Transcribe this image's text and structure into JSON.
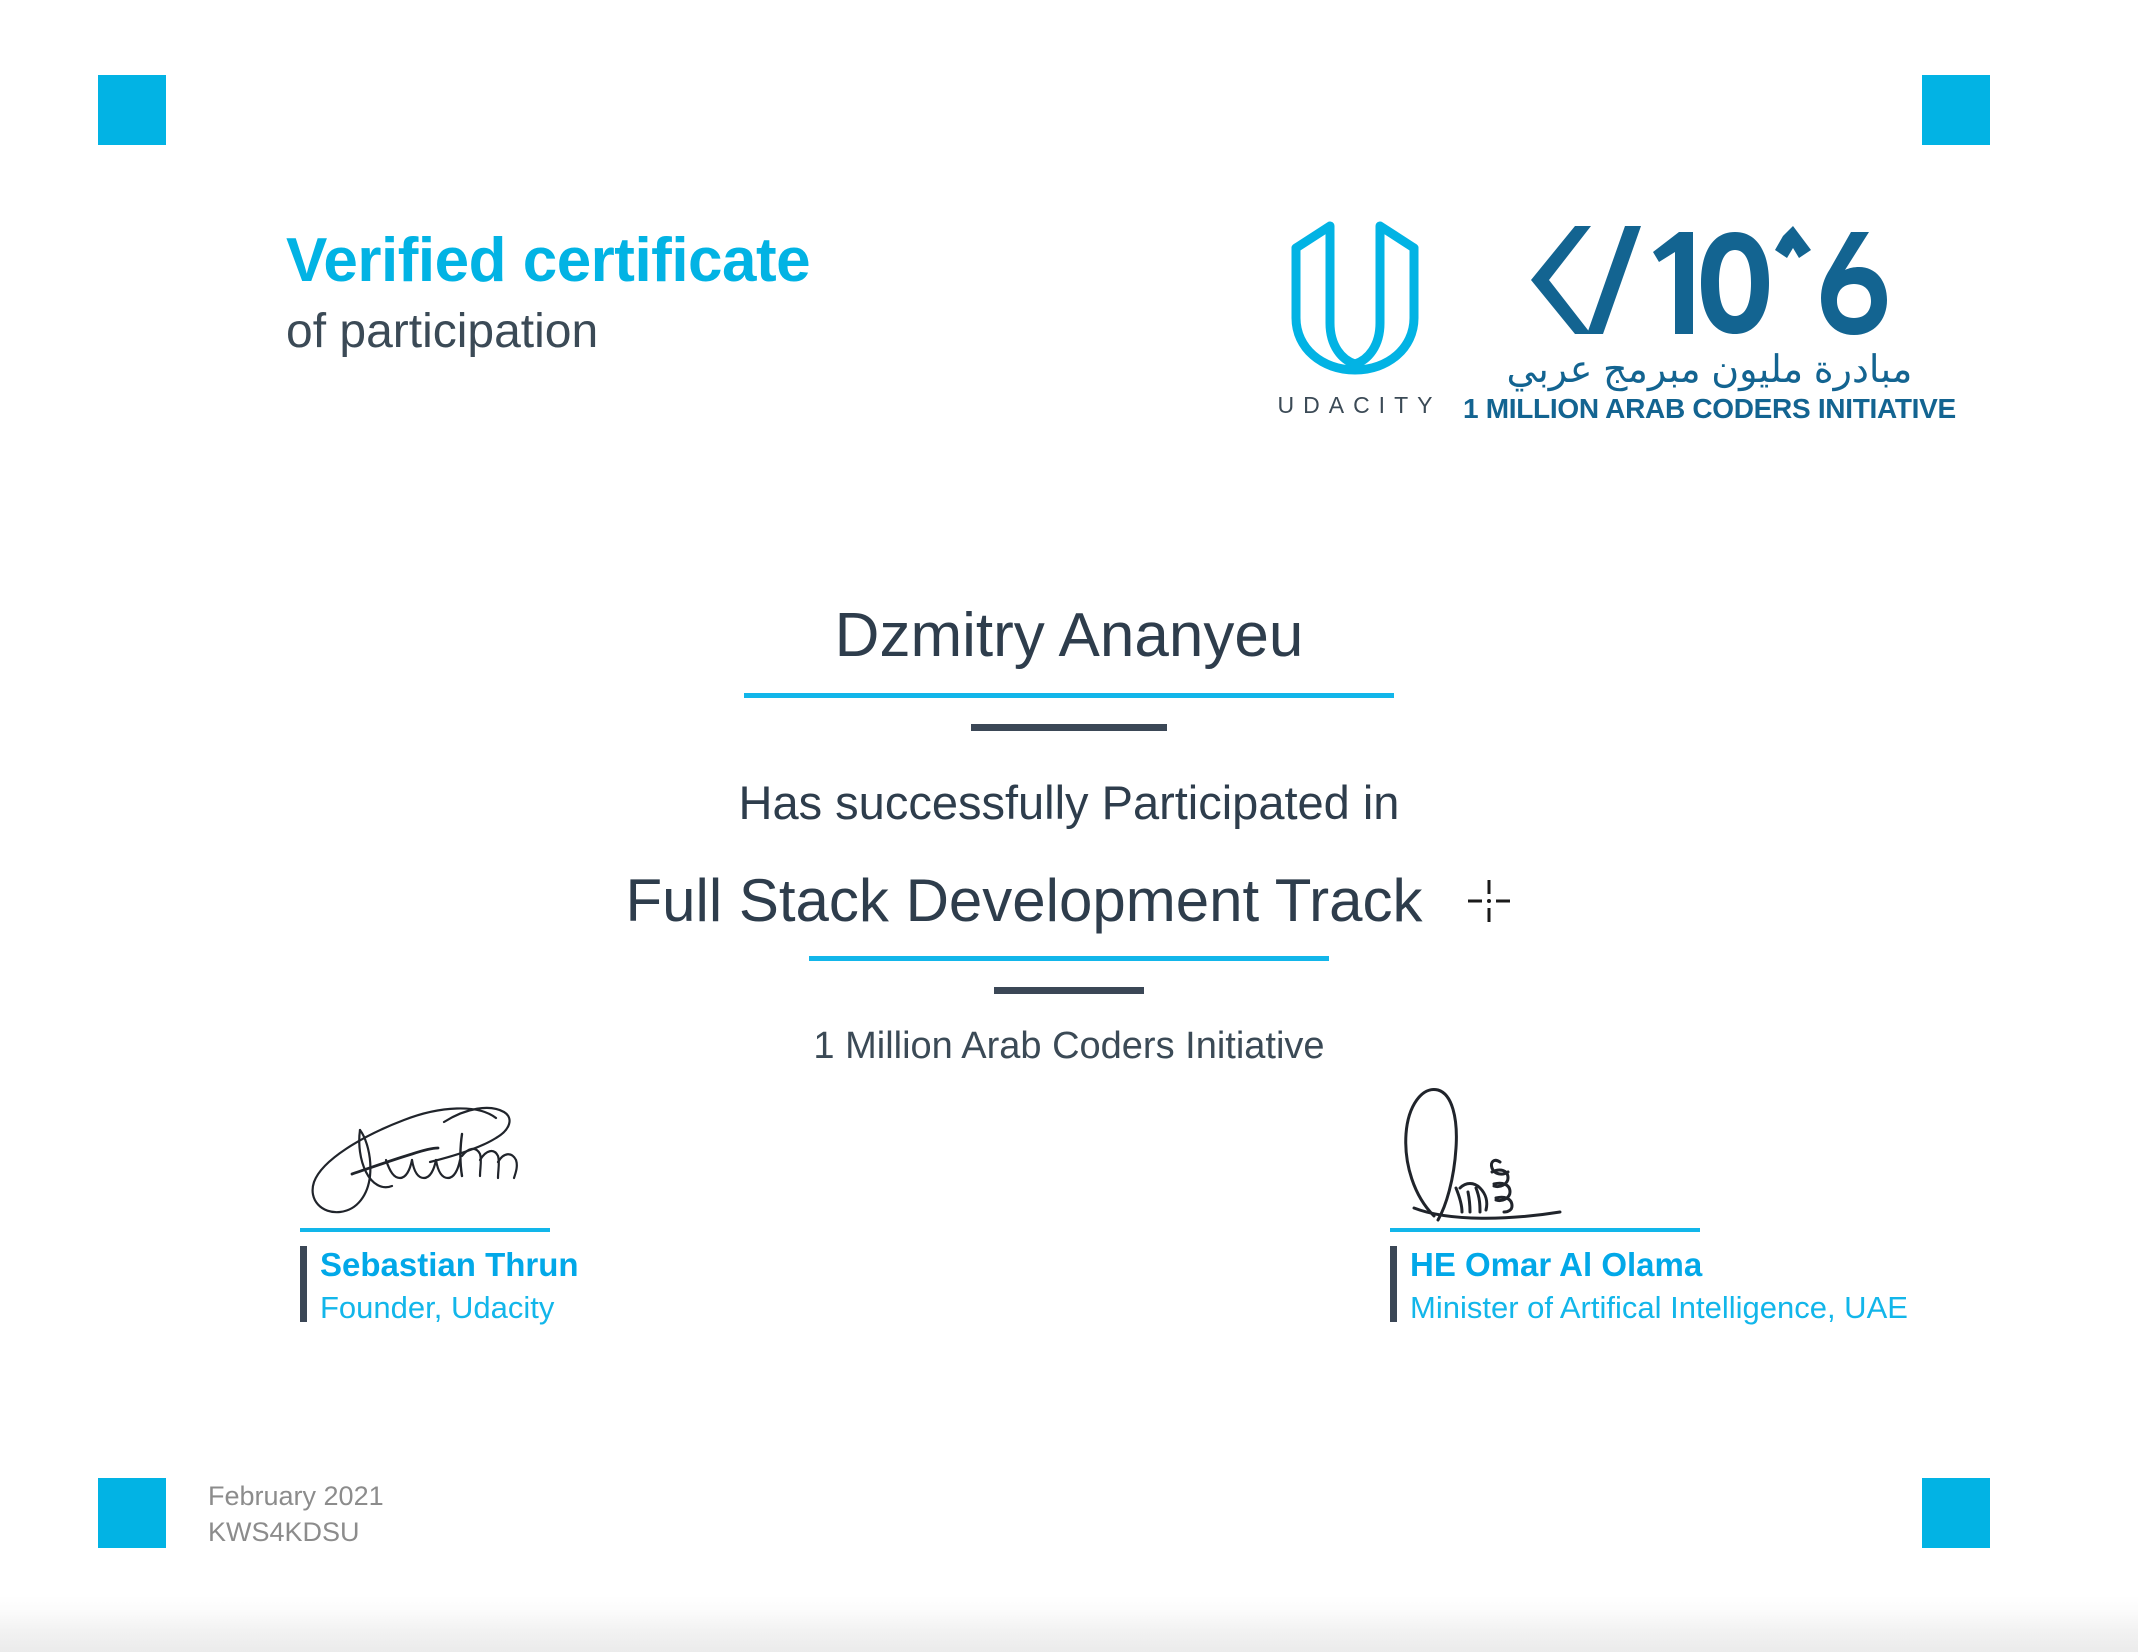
{
  "document": {
    "type": "verified-certificate-of-participation"
  },
  "header": {
    "title": "Verified certificate",
    "subtitle": "of participation"
  },
  "logos": {
    "udacity": {
      "mark_name": "udacity-u-logo",
      "wordmark": "UDACITY"
    },
    "arab_coders": {
      "mark_name": "ten-to-the-sixth-logo",
      "mark_text": "</10^6>",
      "arabic": "مبادرة مليون مبرمج عربي",
      "english": "1 MILLION ARAB CODERS INITIATIVE"
    }
  },
  "body": {
    "recipient_name": "Dzmitry Ananyeu",
    "participation_line": "Has successfully Participated in",
    "track_name": "Full Stack Development Track",
    "program_name": "1 Million Arab Coders Initiative",
    "registration_mark_name": "crosshair-registration-mark"
  },
  "signatures": [
    {
      "name": "Sebastian Thrun",
      "role": "Founder, Udacity",
      "signature_name": "sebastian-thrun-signature"
    },
    {
      "name": "HE Omar Al Olama",
      "role": "Minister of Artifical Intelligence, UAE",
      "signature_name": "omar-al-olama-signature"
    }
  ],
  "footer": {
    "date": "February 2021",
    "certificate_id": "KWS4KDSU"
  },
  "colors": {
    "accent_cyan": "#02B3E4",
    "rule_cyan": "#12B6EA",
    "dark_slate": "#2E3D4C",
    "logo_teal": "#136491",
    "muted_gray": "#8C8C8C"
  }
}
